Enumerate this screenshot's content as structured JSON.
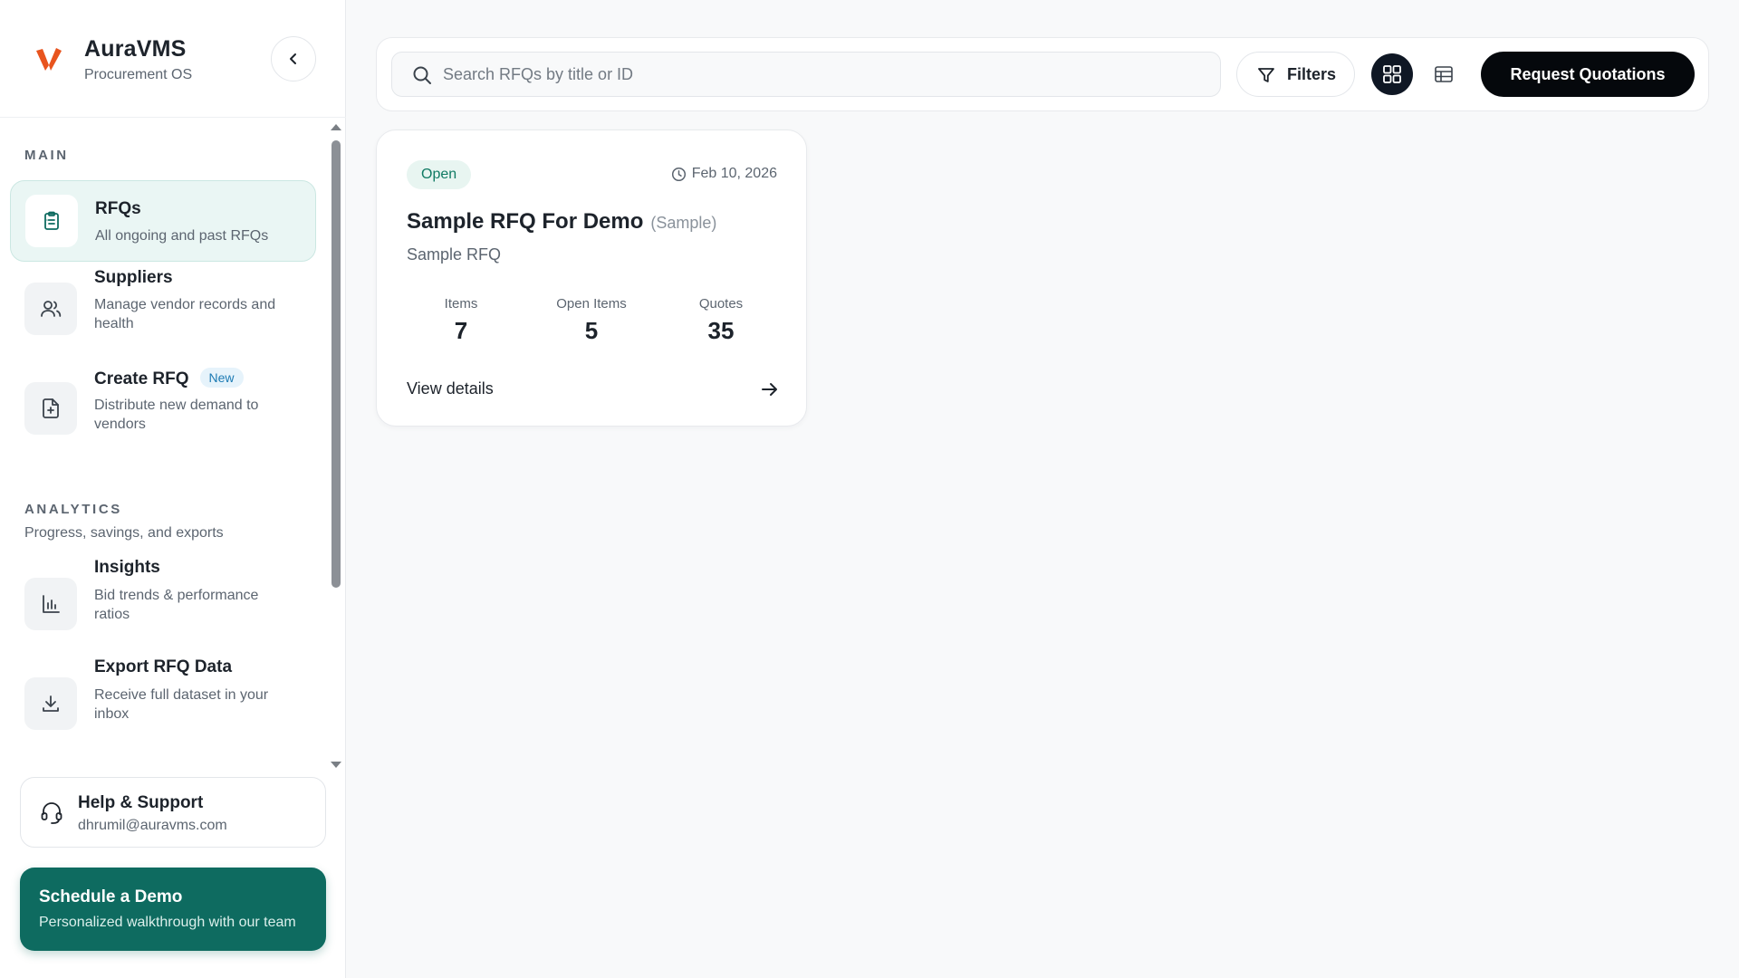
{
  "brand": {
    "name": "AuraVMS",
    "subtitle": "Procurement OS",
    "accent": "#e8541e"
  },
  "sidebar": {
    "main_label": "MAIN",
    "analytics_label": "ANALYTICS",
    "analytics_desc": "Progress, savings, and exports",
    "items": [
      {
        "title": "RFQs",
        "desc": "All ongoing and past RFQs",
        "icon": "clipboard-icon",
        "active": true
      },
      {
        "title": "Suppliers",
        "desc": "Manage vendor records and health",
        "icon": "users-icon"
      },
      {
        "title": "Create RFQ",
        "badge": "New",
        "desc": "Distribute new demand to vendors",
        "icon": "file-plus-icon"
      },
      {
        "title": "Insights",
        "desc": "Bid trends & performance ratios",
        "icon": "bar-chart-icon"
      },
      {
        "title": "Export RFQ Data",
        "desc": "Receive full dataset in your inbox",
        "icon": "download-icon"
      }
    ],
    "help": {
      "title": "Help & Support",
      "email": "dhrumil@auravms.com"
    },
    "demo": {
      "title": "Schedule a Demo",
      "subtitle": "Personalized walkthrough with our team",
      "color": "#0e6b60"
    }
  },
  "toolbar": {
    "search_placeholder": "Search RFQs by title or ID",
    "search_value": "",
    "filters_label": "Filters",
    "view_mode": "grid",
    "request_label": "Request Quotations"
  },
  "rfqs": [
    {
      "status": "Open",
      "date": "Feb 10, 2026",
      "title": "Sample RFQ For Demo",
      "tag": "(Sample)",
      "subtitle": "Sample RFQ",
      "stats": [
        {
          "label": "Items",
          "value": "7"
        },
        {
          "label": "Open Items",
          "value": "5"
        },
        {
          "label": "Quotes",
          "value": "35"
        }
      ],
      "action_label": "View details"
    }
  ]
}
